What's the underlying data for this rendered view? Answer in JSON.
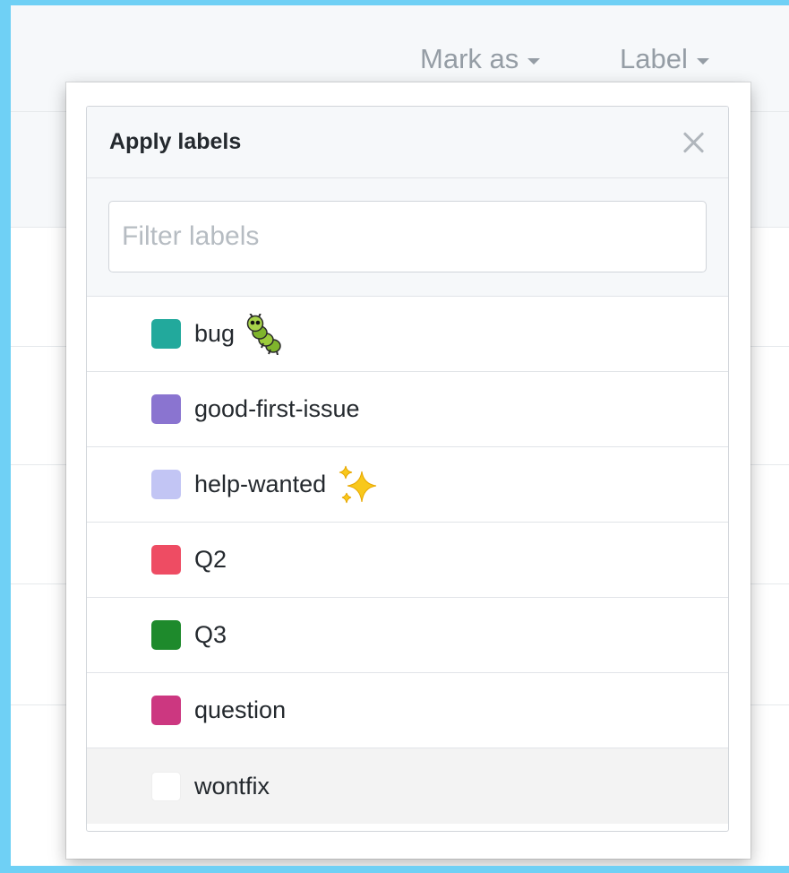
{
  "toolbar": {
    "mark_as_label": "Mark as",
    "label_label": "Label"
  },
  "menu": {
    "title": "Apply labels",
    "filter_placeholder": "Filter labels",
    "filter_value": "",
    "labels": [
      {
        "name": "bug",
        "color": "#22a99c",
        "icon": "caterpillar-icon"
      },
      {
        "name": "good-first-issue",
        "color": "#8a74d0",
        "icon": ""
      },
      {
        "name": "help-wanted",
        "color": "#c2c5f4",
        "icon": "sparkles-icon"
      },
      {
        "name": "Q2",
        "color": "#ee4c63",
        "icon": ""
      },
      {
        "name": "Q3",
        "color": "#1e8a2c",
        "icon": ""
      },
      {
        "name": "question",
        "color": "#cc3780",
        "icon": ""
      },
      {
        "name": "wontfix",
        "color": "#ffffff",
        "icon": ""
      }
    ]
  }
}
